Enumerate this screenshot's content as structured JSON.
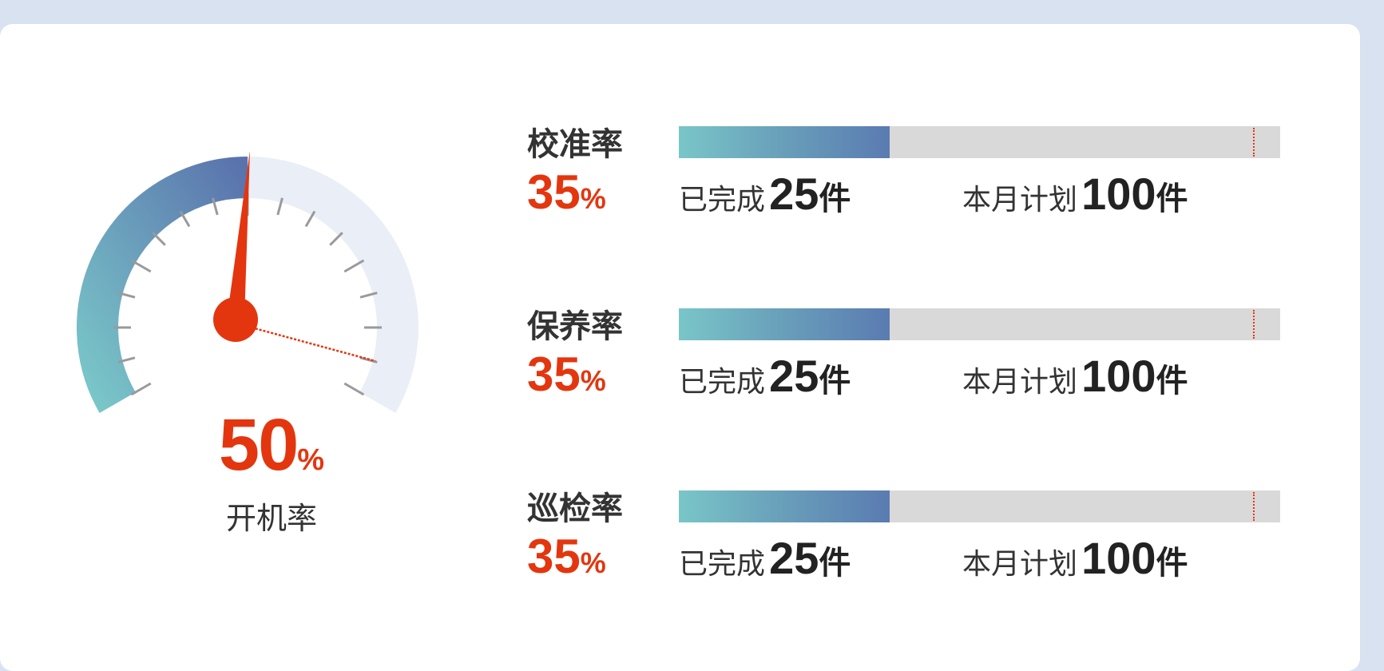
{
  "gauge": {
    "value": 50,
    "display": "50",
    "unit": "%",
    "label": "开机率"
  },
  "metrics": [
    {
      "name": "校准率",
      "rate": "35",
      "rate_unit": "%",
      "completed_label": "已完成",
      "completed": "25",
      "completed_unit": "件",
      "plan_label": "本月计划",
      "plan": "100",
      "plan_unit": "件",
      "progress_fraction": 0.35,
      "plan_marker_fraction": 0.955
    },
    {
      "name": "保养率",
      "rate": "35",
      "rate_unit": "%",
      "completed_label": "已完成",
      "completed": "25",
      "completed_unit": "件",
      "plan_label": "本月计划",
      "plan": "100",
      "plan_unit": "件",
      "progress_fraction": 0.35,
      "plan_marker_fraction": 0.955
    },
    {
      "name": "巡检率",
      "rate": "35",
      "rate_unit": "%",
      "completed_label": "已完成",
      "completed": "25",
      "completed_unit": "件",
      "plan_label": "本月计划",
      "plan": "100",
      "plan_unit": "件",
      "progress_fraction": 0.35,
      "plan_marker_fraction": 0.955
    }
  ],
  "colors": {
    "accent": "#e3360f",
    "gradient_start": "#79c6c8",
    "gradient_end": "#5a7bb1",
    "track": "#d9d9d9",
    "gauge_track": "#eaeef7"
  }
}
